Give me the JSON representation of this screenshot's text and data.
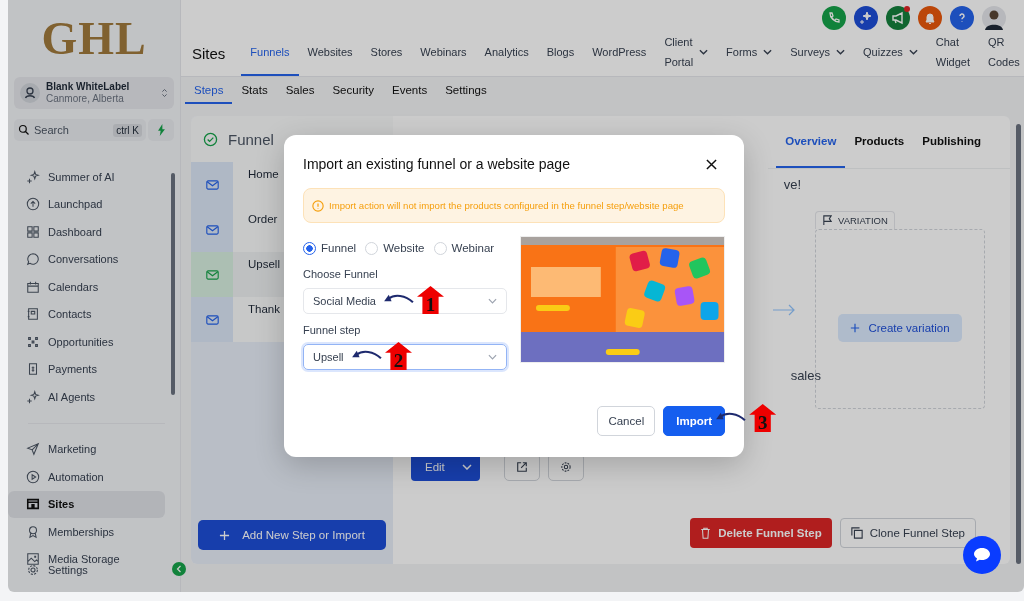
{
  "logo": "GHL",
  "account": {
    "name": "Blank WhiteLabel",
    "location": "Canmore, Alberta"
  },
  "search": {
    "placeholder": "Search",
    "shortcut": "ctrl K"
  },
  "nav_main": [
    {
      "label": "Summer of AI",
      "selected": false
    },
    {
      "label": "Launchpad",
      "selected": false
    },
    {
      "label": "Dashboard",
      "selected": false
    },
    {
      "label": "Conversations",
      "selected": false
    },
    {
      "label": "Calendars",
      "selected": false
    },
    {
      "label": "Contacts",
      "selected": false
    },
    {
      "label": "Opportunities",
      "selected": false
    },
    {
      "label": "Payments",
      "selected": false
    },
    {
      "label": "AI Agents",
      "selected": false
    }
  ],
  "nav_secondary": [
    {
      "label": "Marketing",
      "selected": false
    },
    {
      "label": "Automation",
      "selected": false
    },
    {
      "label": "Sites",
      "selected": true
    },
    {
      "label": "Memberships",
      "selected": false
    },
    {
      "label": "Media Storage",
      "selected": false
    }
  ],
  "settings": "Settings",
  "header_icons": [
    {
      "kind": "phone",
      "badge": false
    },
    {
      "kind": "sparkle",
      "badge": false
    },
    {
      "kind": "megaphone",
      "badge": true
    },
    {
      "kind": "bell",
      "badge": false
    },
    {
      "kind": "help",
      "badge": false
    },
    {
      "kind": "avatar",
      "badge": false
    }
  ],
  "header": {
    "section": "Sites",
    "tabs": [
      {
        "label": "Funnels",
        "selected": true,
        "dropdown": false
      },
      {
        "label": "Websites",
        "selected": false,
        "dropdown": false
      },
      {
        "label": "Stores",
        "selected": false,
        "dropdown": false
      },
      {
        "label": "Webinars",
        "selected": false,
        "dropdown": false
      },
      {
        "label": "Analytics",
        "selected": false,
        "dropdown": false
      },
      {
        "label": "Blogs",
        "selected": false,
        "dropdown": false
      },
      {
        "label": "WordPress",
        "selected": false,
        "dropdown": false
      },
      {
        "label": "Client Portal",
        "selected": false,
        "dropdown": true
      },
      {
        "label": "Forms",
        "selected": false,
        "dropdown": true
      },
      {
        "label": "Surveys",
        "selected": false,
        "dropdown": true
      },
      {
        "label": "Quizzes",
        "selected": false,
        "dropdown": true
      },
      {
        "label": "Chat Widget",
        "selected": false,
        "dropdown": false
      },
      {
        "label": "QR Codes",
        "selected": false,
        "dropdown": false
      }
    ]
  },
  "subtabs": [
    {
      "label": "Steps",
      "selected": true
    },
    {
      "label": "Stats",
      "selected": false
    },
    {
      "label": "Sales",
      "selected": false
    },
    {
      "label": "Security",
      "selected": false
    },
    {
      "label": "Events",
      "selected": false
    },
    {
      "label": "Settings",
      "selected": false
    }
  ],
  "funnel": {
    "title": "Funnel",
    "steps": [
      {
        "name": "Home",
        "selected": false
      },
      {
        "name": "Order",
        "selected": false
      },
      {
        "name": "Upsell",
        "selected": true
      },
      {
        "name": "Thank",
        "selected": false
      }
    ],
    "add_button": "Add New Step or Import"
  },
  "detail": {
    "tabs": [
      {
        "label": "Overview",
        "selected": true
      },
      {
        "label": "Products",
        "selected": false
      },
      {
        "label": "Publishing",
        "selected": false
      }
    ],
    "text_top": "ve!",
    "text_bottom": "sales",
    "edit_button": "Edit",
    "variation_tag": "VARIATION",
    "create_variation": "Create variation",
    "delete_button": "Delete Funnel Step",
    "clone_button": "Clone Funnel Step"
  },
  "modal": {
    "title": "Import an existing funnel or a website page",
    "alert": "Import action will not import the products configured in the funnel step/website page",
    "source_options": [
      {
        "label": "Funnel",
        "selected": true
      },
      {
        "label": "Website",
        "selected": false
      },
      {
        "label": "Webinar",
        "selected": false
      }
    ],
    "fields": [
      {
        "label": "Choose Funnel",
        "value": "Social Media",
        "focused": false,
        "callout": "1"
      },
      {
        "label": "Funnel step",
        "value": "Upsell",
        "focused": true,
        "callout": "2"
      }
    ],
    "buttons": [
      {
        "label": "Cancel",
        "kind": "secondary"
      },
      {
        "label": "Import",
        "kind": "primary",
        "callout": "3"
      }
    ]
  }
}
